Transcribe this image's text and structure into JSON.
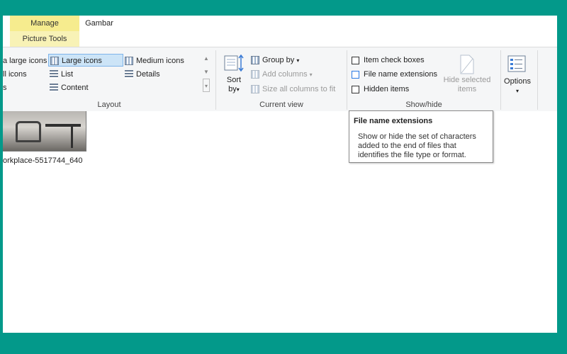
{
  "tabs": {
    "manage": "Manage",
    "gambar": "Gambar",
    "picture_tools": "Picture Tools"
  },
  "layout": {
    "extra_large_icons": "a large icons",
    "small_icons": "ll icons",
    "tiles": "s",
    "large_icons": "Large icons",
    "list": "List",
    "content": "Content",
    "medium_icons": "Medium icons",
    "details": "Details",
    "group_label": "Layout"
  },
  "current_view": {
    "sort_by_line1": "Sort",
    "sort_by_line2": "by",
    "group_by": "Group by",
    "add_columns": "Add columns",
    "size_columns": "Size all columns to fit",
    "group_label": "Current view"
  },
  "show_hide": {
    "item_check_boxes": "Item check boxes",
    "file_name_extensions": "File name extensions",
    "hidden_items": "Hidden items",
    "hide_selected_line1": "Hide selected",
    "hide_selected_line2": "items",
    "group_label": "Show/hide"
  },
  "options": {
    "label": "Options"
  },
  "file": {
    "name": "orkplace-5517744_640"
  },
  "tooltip": {
    "title": "File name extensions",
    "body": "Show or hide the set of characters added to the end of files that identifies the file type or format."
  },
  "colors": {
    "background": "#03998a",
    "manage_tab": "#f6ec8e",
    "selected": "#cce4f7"
  }
}
